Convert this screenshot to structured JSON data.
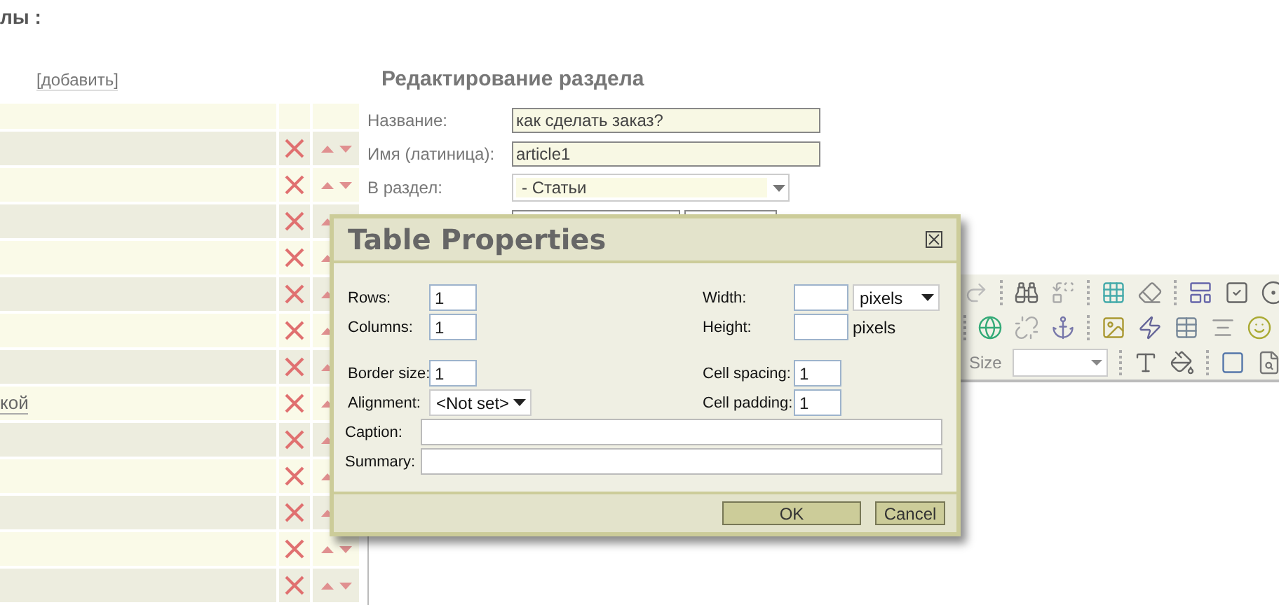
{
  "page_title": "лы :",
  "list": {
    "add_link": "[добавить]",
    "rows": [
      {
        "kind": "blank"
      },
      {
        "kind": "item"
      },
      {
        "kind": "item"
      },
      {
        "kind": "item"
      },
      {
        "kind": "item"
      },
      {
        "kind": "item"
      },
      {
        "kind": "item"
      },
      {
        "kind": "item"
      },
      {
        "kind": "item",
        "title": "кой"
      },
      {
        "kind": "item"
      },
      {
        "kind": "item"
      },
      {
        "kind": "item"
      },
      {
        "kind": "item"
      },
      {
        "kind": "item"
      }
    ]
  },
  "form": {
    "heading": "Редактирование раздела",
    "fields": [
      {
        "kind": "text",
        "label": "Название:",
        "value": "как сделать заказ?"
      },
      {
        "kind": "text",
        "label": "Имя (латиница):",
        "value": "article1"
      },
      {
        "kind": "select",
        "label": "В раздел:",
        "value": "- Статьи"
      },
      {
        "kind": "covered"
      }
    ]
  },
  "editor": {
    "size_label": "Size"
  },
  "dialog": {
    "title": "Table Properties",
    "left": [
      {
        "kind": "input",
        "label": "Rows:",
        "value": "1"
      },
      {
        "kind": "input",
        "label": "Columns:",
        "value": "1"
      },
      {
        "kind": "spacer"
      },
      {
        "kind": "input",
        "label": "Border size:",
        "value": "1"
      },
      {
        "kind": "select",
        "label": "Alignment:",
        "value": "<Not set>"
      }
    ],
    "right": [
      {
        "kind": "unit_select",
        "label": "Width:",
        "unit": "pixels"
      },
      {
        "kind": "unit_text",
        "label": "Height:",
        "unit": "pixels"
      },
      {
        "kind": "spacer"
      },
      {
        "kind": "input",
        "label": "Cell spacing:",
        "value": "1"
      },
      {
        "kind": "input",
        "label": "Cell padding:",
        "value": "1"
      }
    ],
    "wide": [
      {
        "label": "Caption:"
      },
      {
        "label": "Summary:"
      }
    ],
    "buttons": [
      "OK",
      "Cancel"
    ]
  }
}
